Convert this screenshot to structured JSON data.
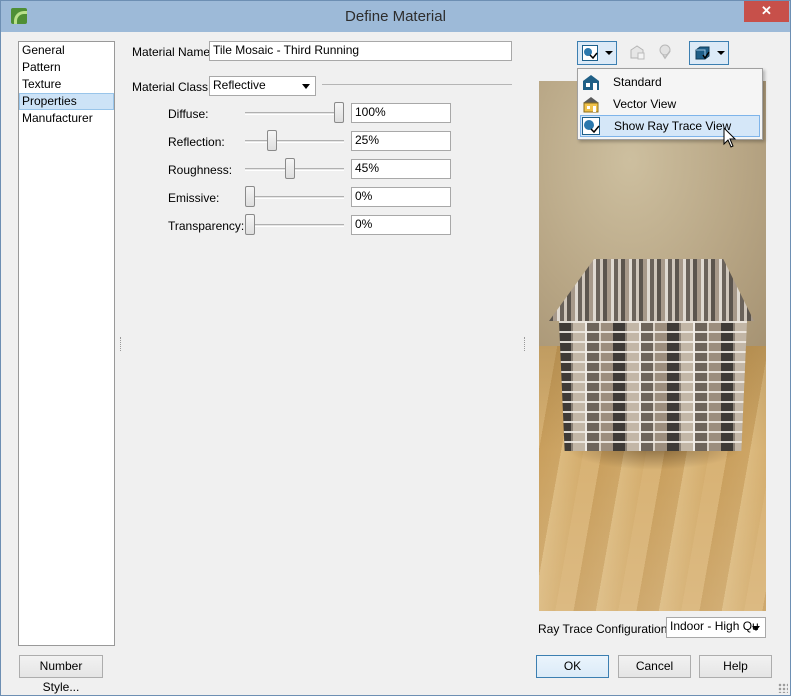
{
  "window": {
    "title": "Define Material",
    "close_glyph": "✕"
  },
  "nav": {
    "items": [
      {
        "label": "General",
        "selected": false
      },
      {
        "label": "Pattern",
        "selected": false
      },
      {
        "label": "Texture",
        "selected": false
      },
      {
        "label": "Properties",
        "selected": true
      },
      {
        "label": "Manufacturer",
        "selected": false
      }
    ]
  },
  "form": {
    "material_name_label": "Material Name:",
    "material_name_value": "Tile Mosaic - Third Running",
    "material_class_label": "Material Class:",
    "material_class_value": "Reflective",
    "properties": [
      {
        "label": "Diffuse:",
        "value": "100%",
        "level": 1.0
      },
      {
        "label": "Reflection:",
        "value": "25%",
        "level": 0.25
      },
      {
        "label": "Roughness:",
        "value": "45%",
        "level": 0.45
      },
      {
        "label": "Emissive:",
        "value": "0%",
        "level": 0.0
      },
      {
        "label": "Transparency:",
        "value": "0%",
        "level": 0.0
      }
    ]
  },
  "preview_toolbar": {
    "view_button_icon": "ray-trace-view-icon",
    "tool2_icon": "material-sample-icon",
    "tool3_icon": "eyedropper-material-icon",
    "tool4_icon": "cube-view-icon"
  },
  "view_menu": {
    "items": [
      {
        "label": "Standard",
        "icon": "standard-view-icon",
        "highlighted": false
      },
      {
        "label": "Vector View",
        "icon": "vector-view-icon",
        "highlighted": false
      },
      {
        "label": "Show Ray Trace View",
        "icon": "ray-trace-view-icon",
        "highlighted": true
      }
    ]
  },
  "ray_trace": {
    "label": "Ray Trace Configuration:",
    "value": "Indoor - High Qu"
  },
  "footer": {
    "number_style_label": "Number Style...",
    "ok_label": "OK",
    "cancel_label": "Cancel",
    "help_label": "Help"
  },
  "colors": {
    "accent": "#3c7fb1",
    "selection": "#cde3f7",
    "titlebar": "#9dbad8",
    "close": "#c7504a"
  }
}
